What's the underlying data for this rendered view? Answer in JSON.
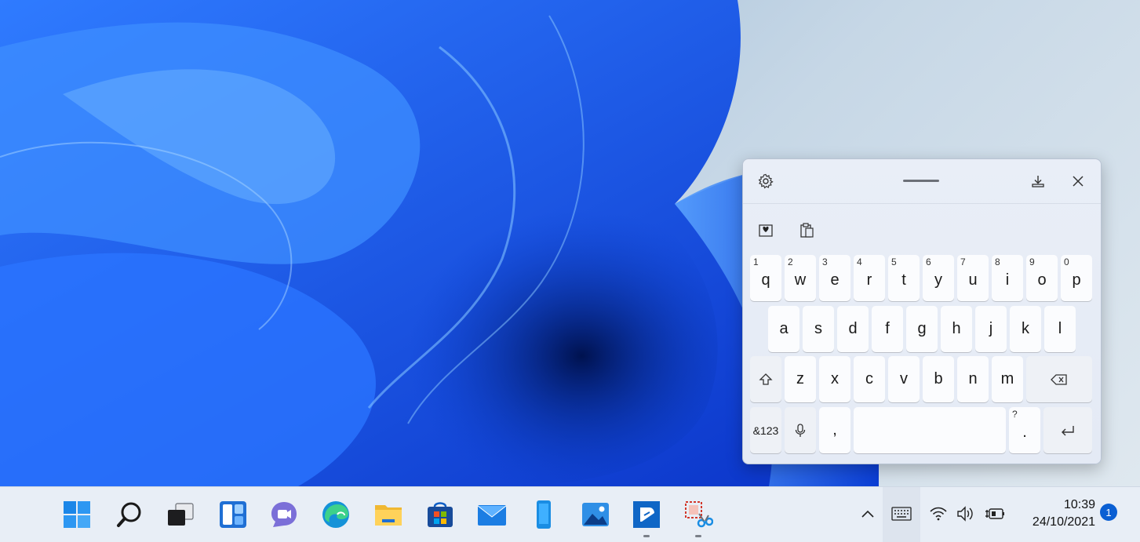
{
  "keyboard": {
    "row1": [
      {
        "hint": "1",
        "key": "q"
      },
      {
        "hint": "2",
        "key": "w"
      },
      {
        "hint": "3",
        "key": "e"
      },
      {
        "hint": "4",
        "key": "r"
      },
      {
        "hint": "5",
        "key": "t"
      },
      {
        "hint": "6",
        "key": "y"
      },
      {
        "hint": "7",
        "key": "u"
      },
      {
        "hint": "8",
        "key": "i"
      },
      {
        "hint": "9",
        "key": "o"
      },
      {
        "hint": "0",
        "key": "p"
      }
    ],
    "row2": [
      "a",
      "s",
      "d",
      "f",
      "g",
      "h",
      "j",
      "k",
      "l"
    ],
    "row3": [
      "z",
      "x",
      "c",
      "v",
      "b",
      "n",
      "m"
    ],
    "symbols_label": "&123",
    "comma": ",",
    "period": ".",
    "period_hint": "?"
  },
  "clock": {
    "time": "10:39",
    "date": "24/10/2021"
  },
  "notification_count": "1",
  "colors": {
    "accent": "#0a5fd3",
    "wallpaper_blue": "#1c5ef0"
  }
}
